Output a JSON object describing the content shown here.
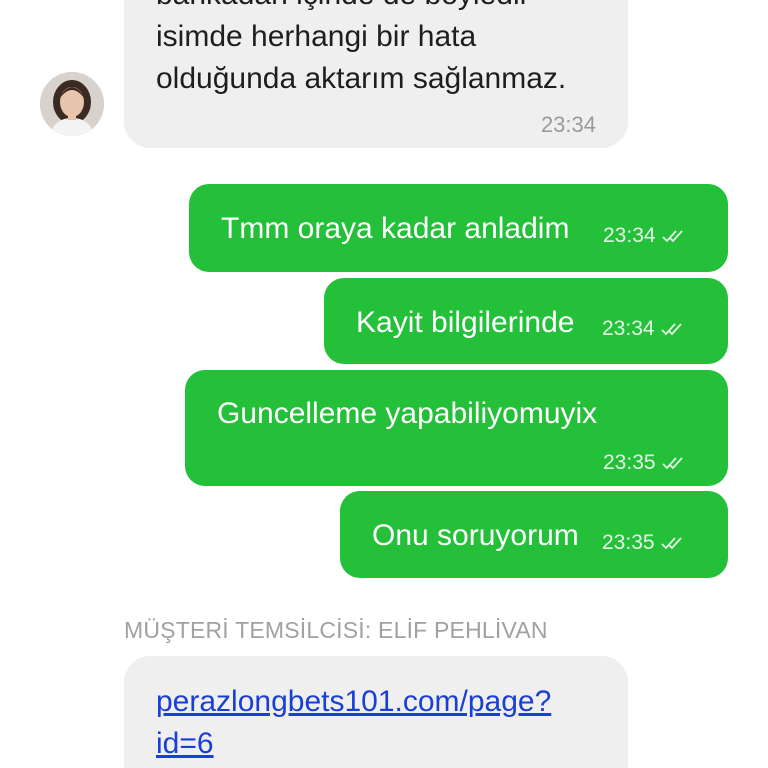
{
  "chat": {
    "incoming_top": {
      "lines": [
        "bankadan içinde de böyledir",
        "isimde herhangi bir hata",
        "olduğunda aktarım sağlanmaz."
      ],
      "time": "23:34"
    },
    "outgoing": [
      {
        "text": "Tmm oraya kadar anladim",
        "time": "23:34"
      },
      {
        "text": "Kayit bilgilerinde",
        "time": "23:34"
      },
      {
        "text": "Guncelleme yapabiliyomuyix",
        "time": "23:35"
      },
      {
        "text": "Onu soruyorum",
        "time": "23:35"
      }
    ],
    "agent_label": "MÜŞTERİ TEMSİLCİSİ: ELİF PEHLİVAN",
    "incoming_bottom": {
      "link_lines": [
        "perazlongbets101.com/page?",
        "id=6"
      ]
    }
  },
  "colors": {
    "outgoing_bubble": "#25c03a",
    "incoming_bubble": "#efefef",
    "link": "#1a3fd6"
  },
  "icons": {
    "read_receipt": "double-check-icon",
    "avatar": "agent-avatar"
  }
}
